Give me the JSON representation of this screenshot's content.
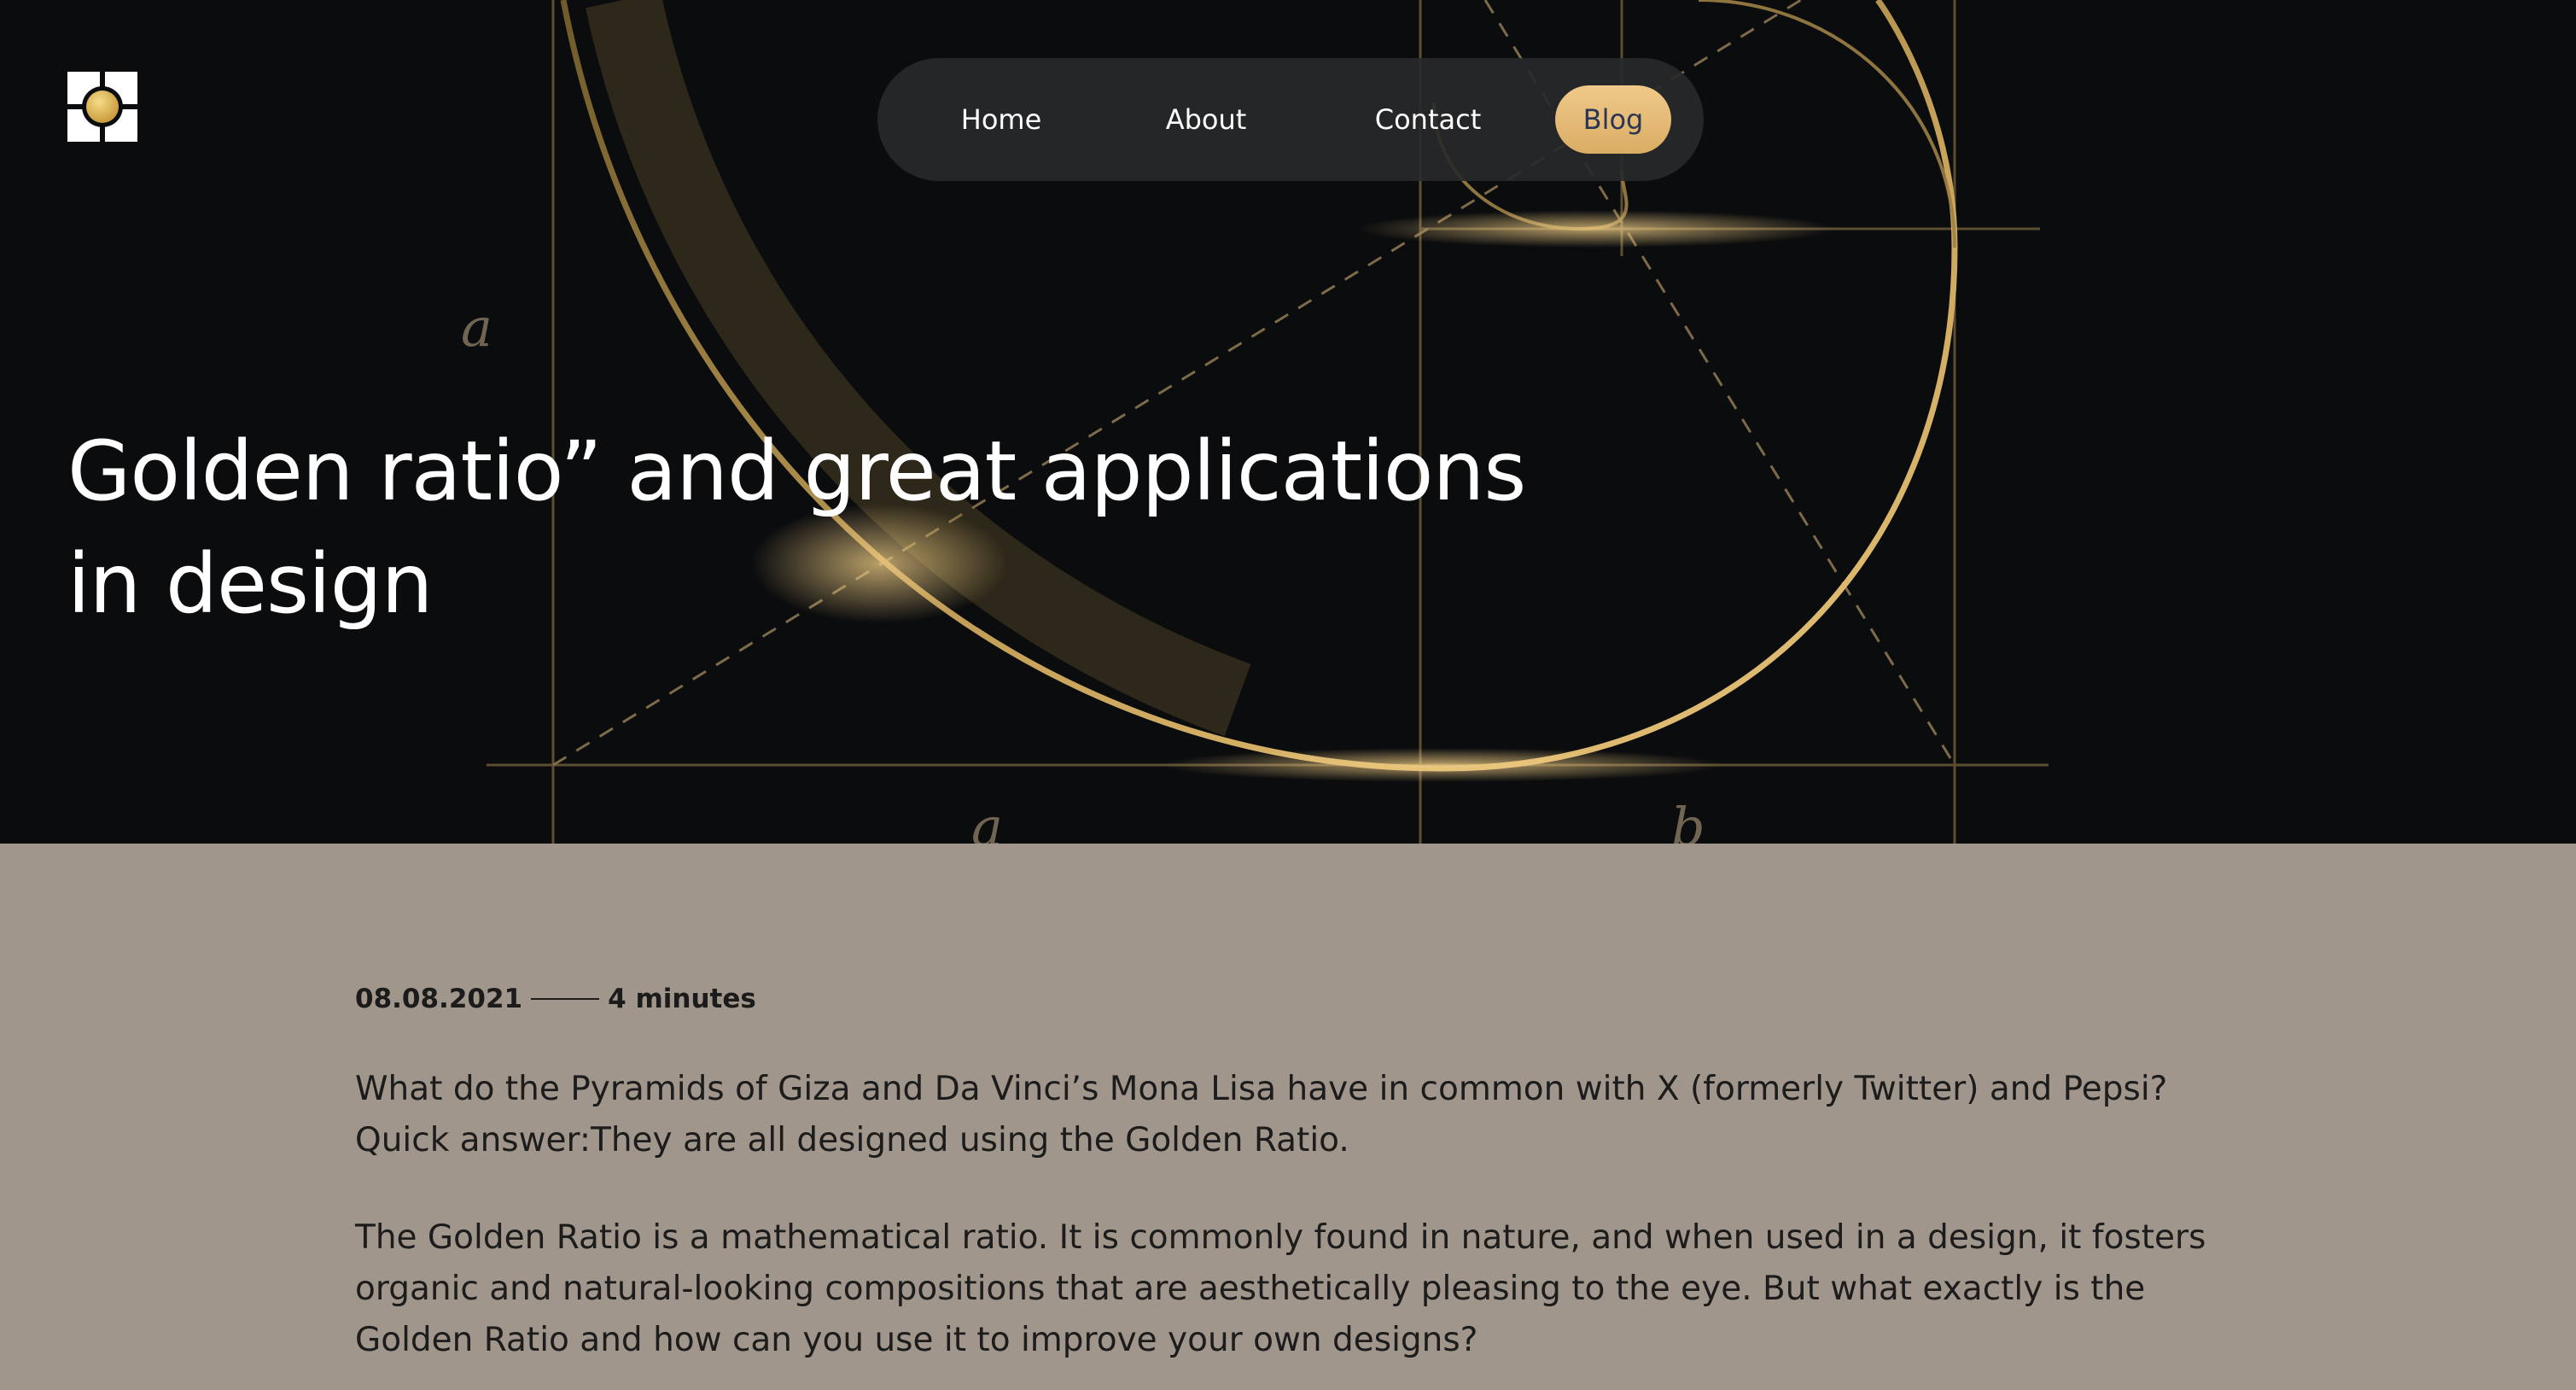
{
  "nav": {
    "items": [
      {
        "label": "Home"
      },
      {
        "label": "About"
      },
      {
        "label": "Contact"
      },
      {
        "label": "Blog",
        "active": true
      }
    ]
  },
  "hero": {
    "title_line1": "Golden ratio” and great applications",
    "title_line2": "in design",
    "diagram_labels": {
      "a_left": "a",
      "a_bottom": "a",
      "b_bottom": "b"
    }
  },
  "article": {
    "date": "08.08.2021",
    "read_time": "4 minutes",
    "paragraph1_line1": "What do the Pyramids of Giza and Da Vinci’s Mona Lisa have in common with X (formerly Twitter) and Pepsi?",
    "paragraph1_line2": "Quick answer:They are all designed using the Golden Ratio.",
    "paragraph2_line1": "The Golden Ratio is a mathematical ratio. It is commonly found in nature, and when used in a design, it fosters",
    "paragraph2_line2": "organic and natural-looking compositions that are aesthetically pleasing to the eye. But what exactly is the",
    "paragraph2_line3": "Golden Ratio and how can you use it to improve your own designs?"
  },
  "colors": {
    "hero_bg": "#0b0c0e",
    "article_bg": "#a1968b",
    "accent_gold": "#e3b877",
    "nav_bg": "#28292a",
    "active_text": "#2b3554"
  },
  "icons": {
    "logo": "golden-circle-logo-icon"
  }
}
